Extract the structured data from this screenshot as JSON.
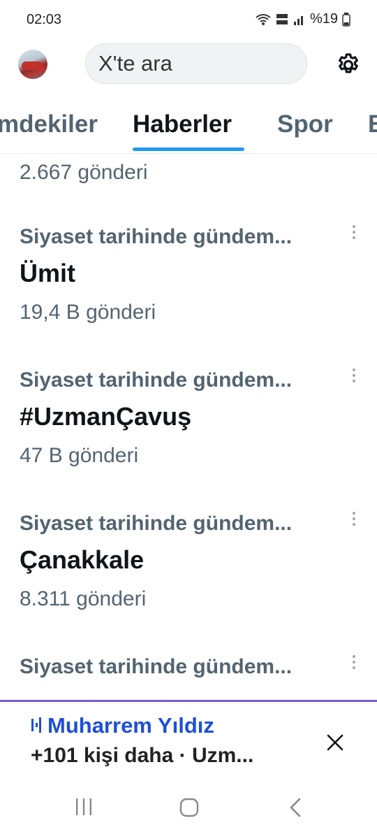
{
  "status": {
    "time": "02:03",
    "battery": "%19",
    "icons": [
      "wifi-icon",
      "volte-icon",
      "signal-icon",
      "battery-icon"
    ]
  },
  "header": {
    "avatar": "avatar",
    "search_placeholder": "X'te ara",
    "settings_icon": "gear-icon"
  },
  "tabs": [
    {
      "label": "mdekiler",
      "active": false
    },
    {
      "label": "Haberler",
      "active": true
    },
    {
      "label": "Spor",
      "active": false
    },
    {
      "label": "E",
      "active": false
    }
  ],
  "feed": {
    "partial_count": "2.667 gönderi",
    "trends": [
      {
        "context": "Siyaset tarihinde gündem...",
        "title": "Ümit",
        "count": "19,4 B gönderi"
      },
      {
        "context": "Siyaset tarihinde gündem...",
        "title": "#UzmanÇavuş",
        "count": "47 B gönderi"
      },
      {
        "context": "Siyaset tarihinde gündem...",
        "title": "Çanakkale",
        "count": "8.311 gönderi"
      },
      {
        "context": "Siyaset tarihinde gündem...",
        "title": "",
        "count": ""
      }
    ]
  },
  "banner": {
    "title": "Muharrem Yıldız",
    "subtitle": "+101 kişi daha · Uzm...",
    "close_icon": "close-icon",
    "accent": "#7b5cd6"
  },
  "nav": {
    "icons": [
      "recents-icon",
      "home-icon",
      "back-icon"
    ]
  },
  "colors": {
    "accent": "#1d9bf0",
    "text": "#0f1419",
    "secondary": "#536471"
  }
}
